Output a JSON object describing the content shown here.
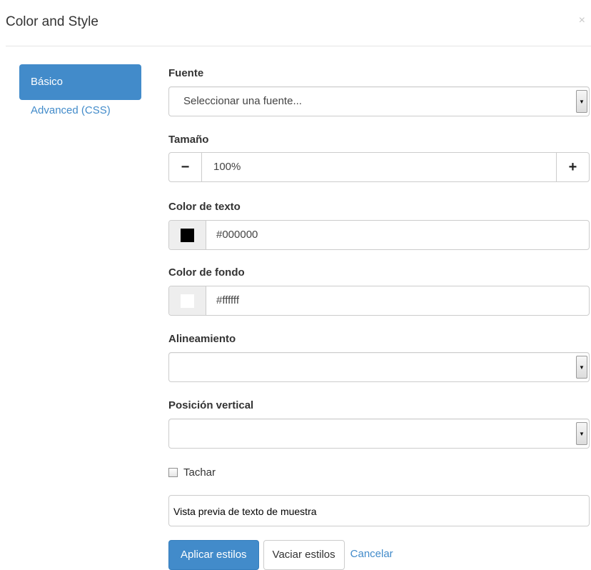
{
  "dialog": {
    "title": "Color and Style",
    "close_glyph": "×"
  },
  "nav": {
    "items": [
      {
        "label": "Básico"
      },
      {
        "label": "Advanced (CSS)"
      }
    ]
  },
  "form": {
    "font": {
      "label": "Fuente",
      "value": "Seleccionar una fuente..."
    },
    "size": {
      "label": "Tamaño",
      "value": "100%",
      "minus": "−",
      "plus": "+"
    },
    "text_color": {
      "label": "Color de texto",
      "value": "#000000",
      "swatch": "#000000"
    },
    "background_color": {
      "label": "Color de fondo",
      "value": "#ffffff",
      "swatch": "#ffffff"
    },
    "alignment": {
      "label": "Alineamiento",
      "value": ""
    },
    "vertical_position": {
      "label": "Posición vertical",
      "value": ""
    },
    "strikethrough": {
      "label": "Tachar",
      "checked": false
    },
    "preview": {
      "text": "Vista previa de texto de muestra"
    }
  },
  "buttons": {
    "apply": "Aplicar estilos",
    "clear": "Vaciar estilos",
    "cancel": "Cancelar"
  },
  "icons": {
    "select_arrow": "chevron-down-icon",
    "minus": "minus-icon",
    "plus": "plus-icon",
    "close": "close-icon"
  },
  "colors": {
    "accent": "#428bca",
    "border": "#cccccc",
    "swatch_bg": "#eeeeee"
  }
}
